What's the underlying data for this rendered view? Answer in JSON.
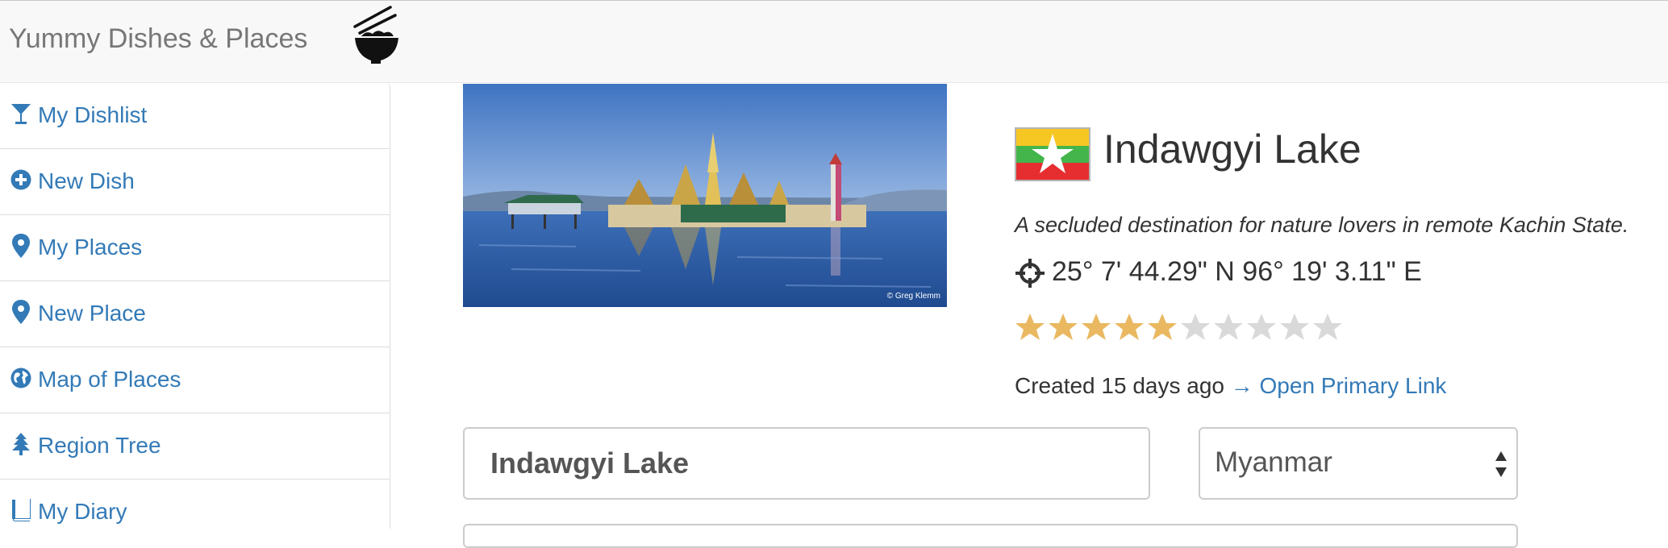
{
  "navbar": {
    "brand": "Yummy Dishes & Places",
    "logo_icon": "rice-bowl-chopsticks-icon"
  },
  "sidebar": {
    "items": [
      {
        "label": "My Dishlist",
        "icon": "cocktail-glass-icon"
      },
      {
        "label": "New Dish",
        "icon": "plus-circle-icon"
      },
      {
        "label": "My Places",
        "icon": "map-marker-icon"
      },
      {
        "label": "New Place",
        "icon": "map-marker-icon"
      },
      {
        "label": "Map of Places",
        "icon": "globe-icon"
      },
      {
        "label": "Region Tree",
        "icon": "tree-icon"
      },
      {
        "label": "My Diary",
        "icon": "book-icon"
      }
    ]
  },
  "place": {
    "photo_credit": "© Greg Klemm",
    "flag_icon": "myanmar-flag",
    "name": "Indawgyi Lake",
    "tagline": "A secluded destination for nature lovers in remote Kachin State.",
    "coordinates": "25° 7' 44.29\" N 96° 19' 3.11\" E",
    "rating": 5,
    "rating_max": 10,
    "created_text": "Created 15 days ago",
    "link_text": "→ Open Primary Link"
  },
  "form": {
    "name_value": "Indawgyi Lake",
    "country_value": "Myanmar"
  },
  "colors": {
    "link": "#337ab7",
    "star_filled": "#e9b860",
    "star_empty": "#d9d9d9"
  }
}
